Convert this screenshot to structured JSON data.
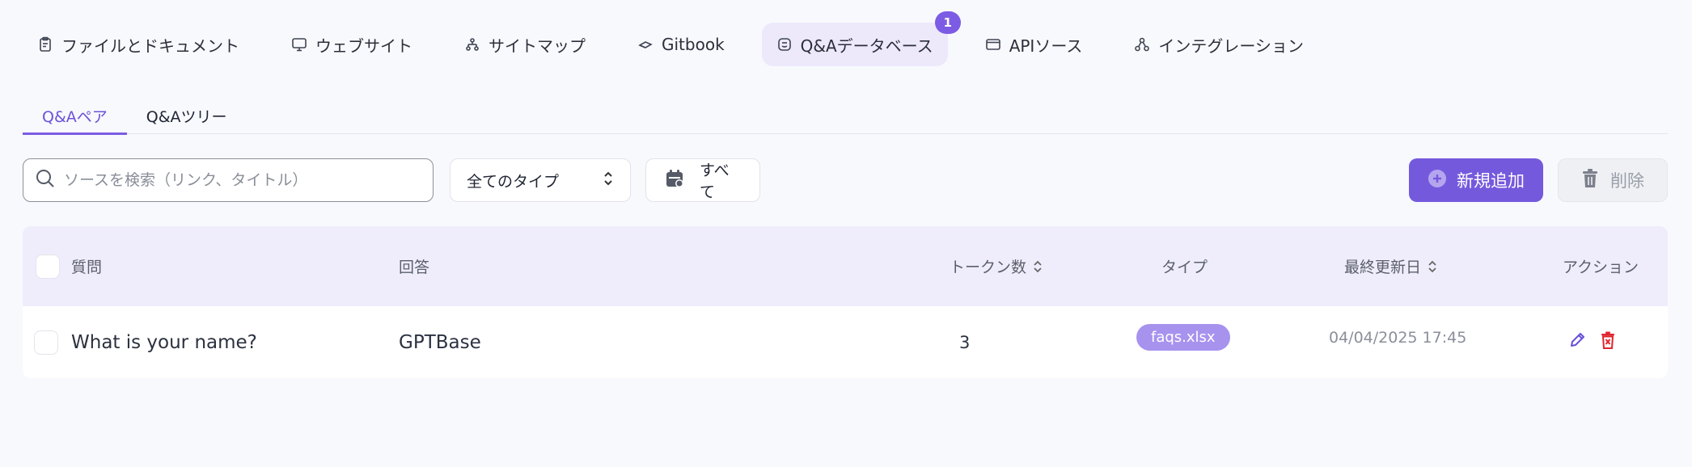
{
  "source_tabs": [
    {
      "label": "ファイルとドキュメント",
      "icon": "document-icon"
    },
    {
      "label": "ウェブサイト",
      "icon": "monitor-icon"
    },
    {
      "label": "サイトマップ",
      "icon": "sitemap-icon"
    },
    {
      "label": "Gitbook",
      "icon": "gitbook-icon"
    },
    {
      "label": "Q&Aデータベース",
      "icon": "qa-icon",
      "active": true,
      "badge": "1"
    },
    {
      "label": "APIソース",
      "icon": "window-icon"
    },
    {
      "label": "インテグレーション",
      "icon": "integration-icon"
    }
  ],
  "sub_tabs": [
    {
      "label": "Q&Aペア",
      "active": true
    },
    {
      "label": "Q&Aツリー"
    }
  ],
  "toolbar": {
    "search_placeholder": "ソースを検索（リンク、タイトル）",
    "type_select_value": "全てのタイプ",
    "date_filter_label": "すべて",
    "add_label": "新規追加",
    "delete_label": "削除"
  },
  "table": {
    "headers": {
      "question": "質問",
      "answer": "回答",
      "tokens": "トークン数",
      "type": "タイプ",
      "updated": "最終更新日",
      "actions": "アクション"
    },
    "rows": [
      {
        "question": "What is your name?",
        "answer": "GPTBase",
        "tokens": "3",
        "type": "faqs.xlsx",
        "updated": "04/04/2025 17:45"
      }
    ]
  },
  "colors": {
    "accent": "#7559dd",
    "active_tab_bg": "#ede9fb",
    "header_bg": "#efedfb",
    "type_badge": "#a792ee",
    "delete_icon": "#e0242f",
    "edit_icon": "#6a4fd6"
  }
}
